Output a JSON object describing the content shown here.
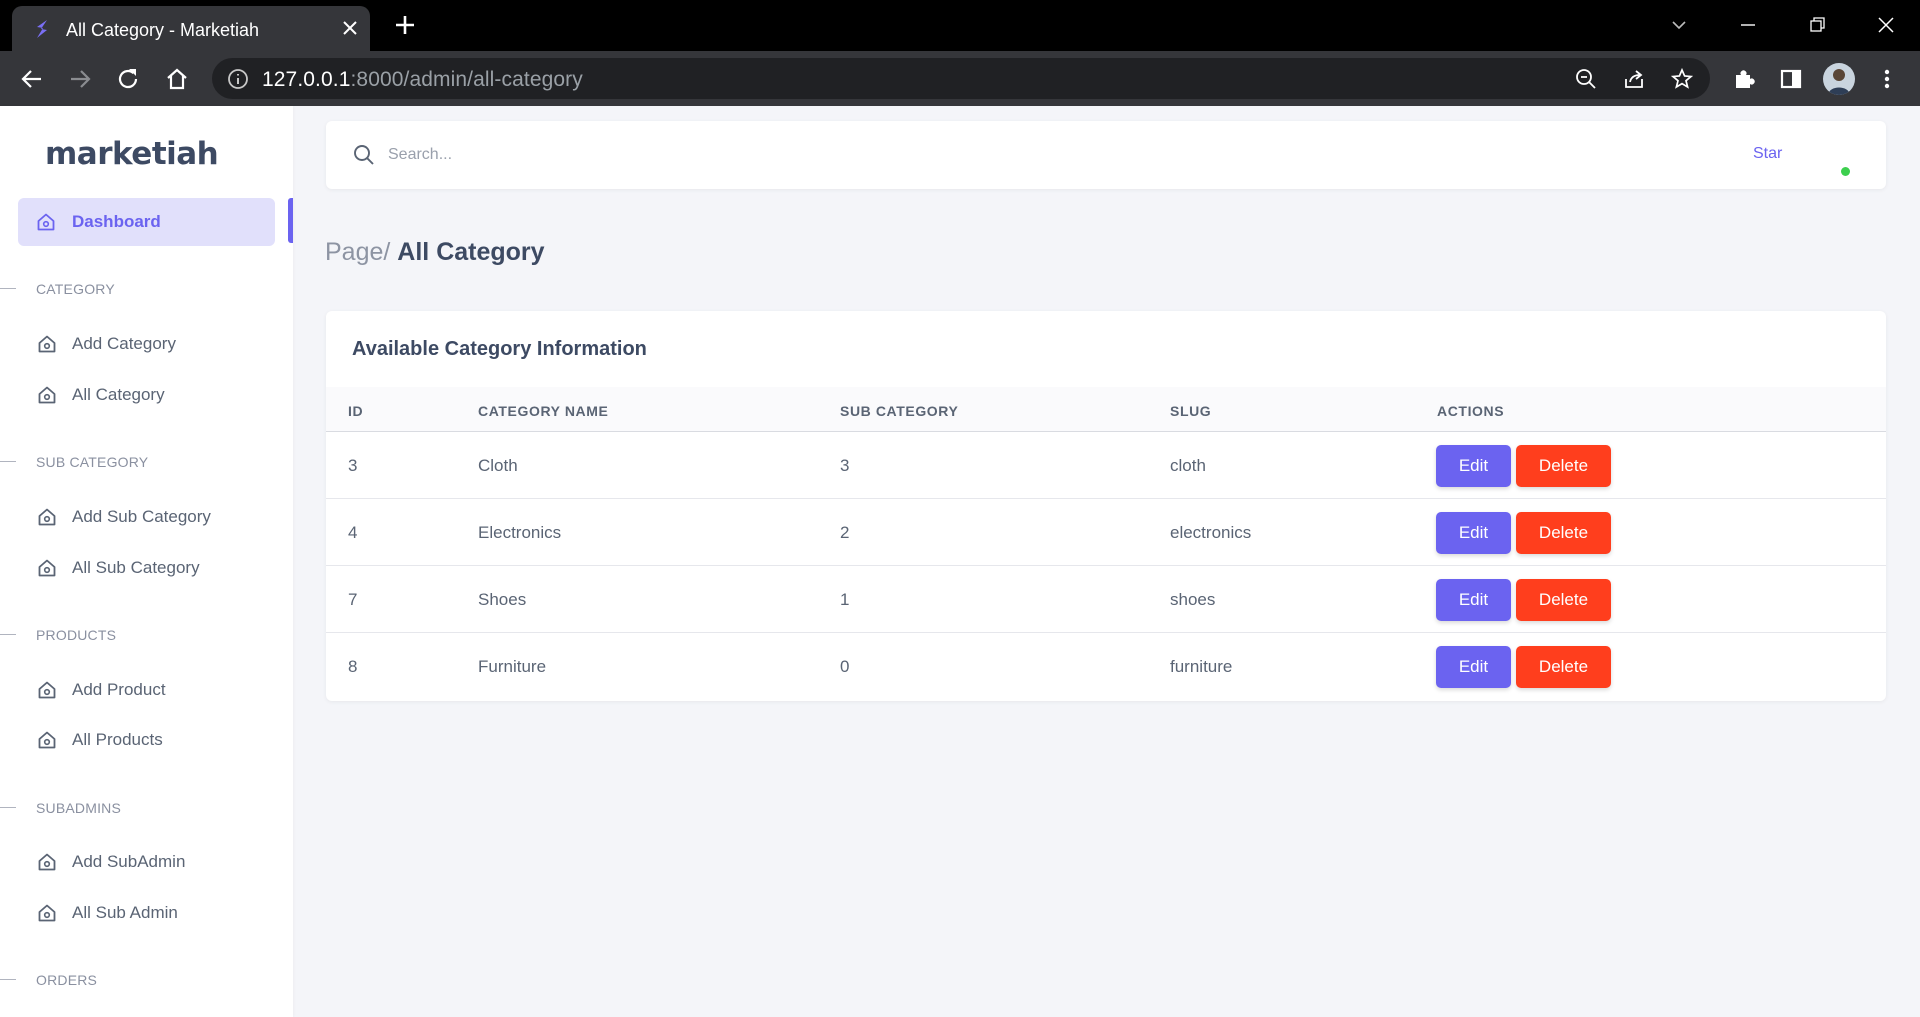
{
  "browser": {
    "tab_title": "All Category - Marketiah",
    "url_host": "127.0.0.1",
    "url_rest": ":8000/admin/all-category"
  },
  "sidebar": {
    "logo": "marketiah",
    "active_item": "Dashboard",
    "sections": [
      {
        "title": "CATEGORY",
        "items": [
          "Add Category",
          "All Category"
        ]
      },
      {
        "title": "SUB CATEGORY",
        "items": [
          "Add Sub Category",
          "All Sub Category"
        ]
      },
      {
        "title": "PRODUCTS",
        "items": [
          "Add Product",
          "All Products"
        ]
      },
      {
        "title": "SUBADMINS",
        "items": [
          "Add SubAdmin",
          "All Sub Admin"
        ]
      },
      {
        "title": "ORDERS",
        "items": []
      }
    ]
  },
  "topbar": {
    "search_placeholder": "Search...",
    "star_link": "Star"
  },
  "breadcrumb": {
    "page": "Page/",
    "current": "All Category"
  },
  "table": {
    "title": "Available Category Information",
    "columns": [
      "ID",
      "CATEGORY NAME",
      "SUB CATEGORY",
      "SLUG",
      "ACTIONS"
    ],
    "edit_label": "Edit",
    "delete_label": "Delete",
    "rows": [
      {
        "id": "3",
        "name": "Cloth",
        "sub_category": "3",
        "slug": "cloth"
      },
      {
        "id": "4",
        "name": "Electronics",
        "sub_category": "2",
        "slug": "electronics"
      },
      {
        "id": "7",
        "name": "Shoes",
        "sub_category": "1",
        "slug": "shoes"
      },
      {
        "id": "8",
        "name": "Furniture",
        "sub_category": "0",
        "slug": "furniture"
      }
    ]
  },
  "colors": {
    "accent": "#6b63f0",
    "danger": "#ff3e1d",
    "online": "#3ccf4e"
  }
}
